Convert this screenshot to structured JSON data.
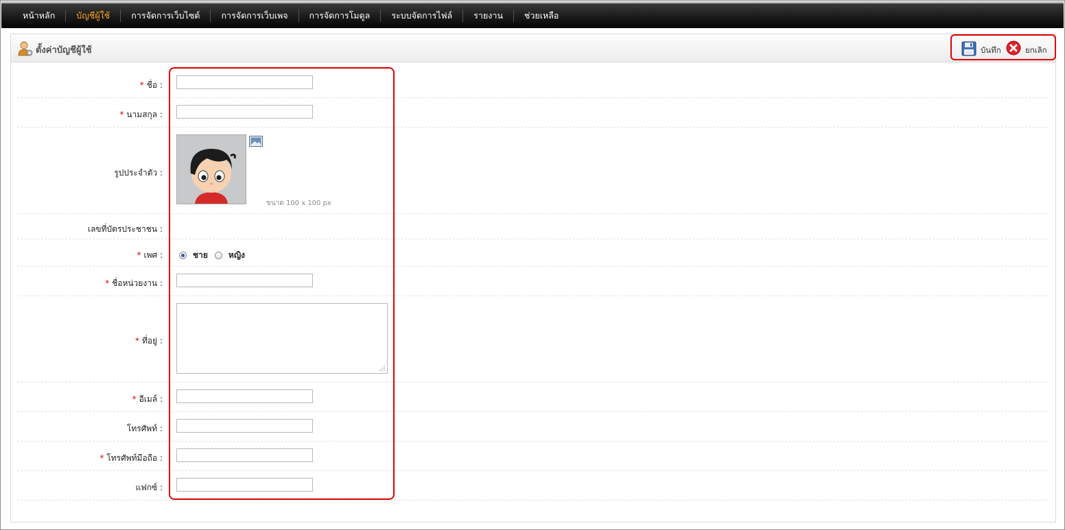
{
  "nav": {
    "items": [
      {
        "label": "หน้าหลัก",
        "active": false
      },
      {
        "label": "บัญชีผู้ใช้",
        "active": true
      },
      {
        "label": "การจัดการเว็บไซต์",
        "active": false
      },
      {
        "label": "การจัดการเว็บเพจ",
        "active": false
      },
      {
        "label": "การจัดการโมดูล",
        "active": false
      },
      {
        "label": "ระบบจัดการไฟล์",
        "active": false
      },
      {
        "label": "รายงาน",
        "active": false
      },
      {
        "label": "ช่วยเหลือ",
        "active": false
      }
    ],
    "active_color": "#f7a41d"
  },
  "panel": {
    "title": "ตั้งค่าบัญชีผู้ใช้",
    "title_icon": "user-settings-icon"
  },
  "toolbar": {
    "save_label": "บันทึก",
    "save_icon": "floppy-disk-icon",
    "cancel_label": "ยกเลิก",
    "cancel_icon": "red-x-circle-icon"
  },
  "form": {
    "required_marker": "*",
    "first_name": {
      "label": "ชื่อ :",
      "required": true,
      "value": ""
    },
    "last_name": {
      "label": "นามสกุล :",
      "required": true,
      "value": ""
    },
    "avatar": {
      "label": "รูปประจำตัว :",
      "size_note": "ขนาด 100 x 100 px",
      "upload_icon": "image-icon"
    },
    "national_id": {
      "label": "เลขที่บัตรประชาชน :",
      "required": false
    },
    "gender": {
      "label": "เพศ :",
      "required": true,
      "options": [
        {
          "label": "ชาย",
          "selected": true
        },
        {
          "label": "หญิง",
          "selected": false
        }
      ]
    },
    "department": {
      "label": "ชื่อหน่วยงาน :",
      "required": true,
      "value": ""
    },
    "address": {
      "label": "ที่อยู่ :",
      "required": true,
      "value": ""
    },
    "email": {
      "label": "อีเมล์ :",
      "required": true,
      "value": ""
    },
    "phone": {
      "label": "โทรศัพท์ :",
      "required": false,
      "value": ""
    },
    "mobile": {
      "label": "โทรศัพท์มือถือ :",
      "required": true,
      "value": ""
    },
    "fax": {
      "label": "แฟกซ์ :",
      "required": false,
      "value": ""
    }
  },
  "highlight_color": "#e00000"
}
